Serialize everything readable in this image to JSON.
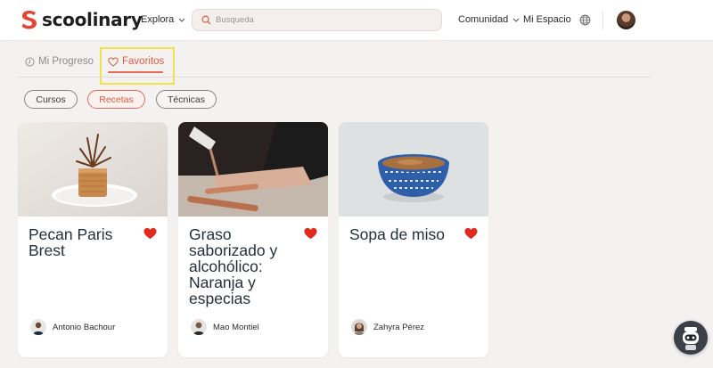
{
  "brand": {
    "name": "scoolinary",
    "accent": "#e3452f"
  },
  "header": {
    "explora": "Explora",
    "search_placeholder": "Busqueda",
    "comunidad": "Comunidad",
    "mi_espacio": "Mi Espacio"
  },
  "tabs": [
    {
      "label": "Mi Progreso",
      "active": false
    },
    {
      "label": "Favoritos",
      "active": true
    }
  ],
  "filters": [
    {
      "label": "Cursos",
      "active": false
    },
    {
      "label": "Recetas",
      "active": true
    },
    {
      "label": "Técnicas",
      "active": false
    }
  ],
  "cards": [
    {
      "title": "Pecan Paris Brest",
      "author": "Antonio Bachour",
      "favorite": true
    },
    {
      "title": "Graso saborizado y alcohólico: Naranja y especias",
      "author": "Mao Montiel",
      "favorite": true
    },
    {
      "title": "Sopa de miso",
      "author": "Zahyra Pérez",
      "favorite": true
    }
  ],
  "icons": {
    "logo": "scoolinary-logo-icon",
    "search": "search-icon",
    "globe": "globe-icon",
    "heart": "heart-icon",
    "clock": "clock-icon",
    "chevron": "chevron-down-icon",
    "bot": "chatbot-icon"
  }
}
